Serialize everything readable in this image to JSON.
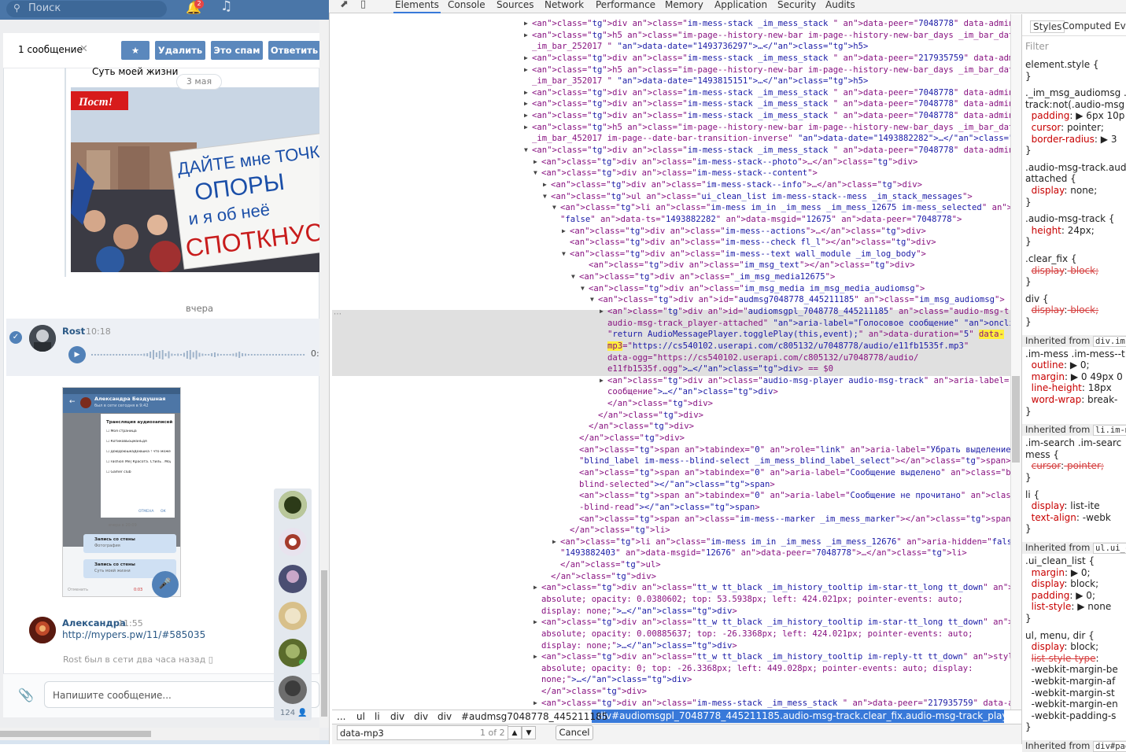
{
  "vk": {
    "search_placeholder": "Поиск",
    "notif_count": "2",
    "selection": {
      "count_label": "1 сообщение",
      "delete": "Удалить",
      "spam": "Это спам",
      "reply": "Ответить"
    },
    "msg1_text": "Суть моей жизни",
    "date_pill": "3 мая",
    "poster_badge": "Пост!",
    "poster_lines": [
      "ДАЙТЕ мне ТОЧКУ",
      "ОПОРЫ",
      "и я об неё",
      "СПОТКНУСЬ"
    ],
    "yesterday": "вчера",
    "rost": {
      "name": "Rost",
      "time": "10:18",
      "duration": "0:"
    },
    "shot": {
      "name": "Александра Бездушная",
      "status": "был в сети сегодня в 9:42",
      "dialog_title": "Трансляция аудиозаписей",
      "options": [
        "Моя страница",
        "КотиковБоцманЕдя",
        "ДоюДоюшкаДоюшка ! что может быть важнее",
        "Fashion Me| Красота. Стиль . Мода",
        "Gamer club"
      ],
      "cancel": "ОТМЕНА",
      "ok": "ОК",
      "date": "вчера в 20:09",
      "item1_title": "Запись со стены",
      "item1_sub": "Фотография",
      "item2_title": "Запись со стены",
      "item2_sub": "Суть моей жизни",
      "bottom_left": "Отменить",
      "bottom_right": "0:03"
    },
    "alex": {
      "name": "Александра",
      "time": "11:55",
      "link": "http://mypers.pw/11/#585035"
    },
    "online_note": "Rost был в сети два часа назад",
    "compose_placeholder": "Напишите сообщение...",
    "friends_count": "124"
  },
  "devtools": {
    "tabs": [
      "Elements",
      "Console",
      "Sources",
      "Network",
      "Performance",
      "Memory",
      "Application",
      "Security",
      "Audits"
    ],
    "active_tab": "Elements",
    "breadcrumbs": [
      "...",
      "ul",
      "li",
      "div",
      "div",
      "div",
      "#audmsg7048778_445211185"
    ],
    "breadcrumb_selected": "div#audiomsgpl_7048778_445211185.audio-msg-track.clear_fix.audio-msg-track_player-attached",
    "find_value": "data-mp3",
    "find_count": "1 of 2",
    "cancel": "Cancel",
    "styles_tabs": [
      "Styles",
      "Computed",
      "Eve"
    ],
    "filter": "Filter",
    "lines": [
      "<div class=\"im-mess-stack _im_mess_stack \" data-peer=\"7048778\" data-admin>…</div>",
      "<h5 class=\"im-page--history-new-bar im-page--history-new-bar_days _im_bar_date",
      "_im_bar_252017 \" data-date=\"1493736297\">…</h5>",
      "<div class=\"im-mess-stack _im_mess_stack \" data-peer=\"217935759\" data-admin>…</div>",
      "<h5 class=\"im-page--history-new-bar im-page--history-new-bar_days _im_bar_date",
      "_im_bar_352017 \" data-date=\"1493815151\">…</h5>",
      "<div class=\"im-mess-stack _im_mess_stack \" data-peer=\"7048778\" data-admin>…</div>",
      "<div class=\"im-mess-stack _im_mess_stack \" data-peer=\"7048778\" data-admin>…</div>",
      "<div class=\"im-mess-stack _im_mess_stack \" data-peer=\"7048778\" data-admin>…</div>",
      "<h5 class=\"im-page--history-new-bar im-page--history-new-bar_days _im_bar_date",
      "_im_bar_452017 im-page--date-bar-transition-inverse\" data-date=\"1493882282\">…</h5>",
      "<div class=\"im-mess-stack _im_mess_stack \" data-peer=\"7048778\" data-admin>",
      "<div class=\"im-mess-stack--photo\">…</div>",
      "<div class=\"im-mess-stack--content\">",
      "<div class=\"im-mess-stack--info\">…</div>",
      "<ul class=\"ui_clean_list im-mess-stack--mess _im_stack_messages\">",
      "<li class=\"im-mess im_in _im_mess _im_mess_12675 im-mess_selected\" aria-hidden=",
      "\"false\" data-ts=\"1493882282\" data-msgid=\"12675\" data-peer=\"7048778\">",
      "<div class=\"im-mess--actions\">…</div>",
      "<div class=\"im-mess--check fl_l\"></div>",
      "<div class=\"im-mess--text wall_module _im_log_body\">",
      "<div class=\"im_msg_text\"></div>",
      "<div class=\"_im_msg_media12675\">",
      "<div class=\"im_msg_media im_msg_media_audiomsg\">",
      "<div id=\"audmsg7048778_445211185\" class=\"im_msg_audiomsg\">",
      "<div id=\"audiomsgpl_7048778_445211185\" class=\"audio-msg-track clear_fix",
      "audio-msg-track_player-attached\" aria-label=\"Голосовое сообщение\" onclick=",
      "\"return AudioMessagePlayer.togglePlay(this,event);\" data-duration=\"5\" data-",
      "mp3=\"https://cs540102.userapi.com/c805132/u7048778/audio/e11fb1535f.mp3\"",
      "data-ogg=\"https://cs540102.userapi.com/c805132/u7048778/audio/",
      "e11fb1535f.ogg\">…</div> == $0",
      "<div class=\"audio-msg-player audio-msg-track\" aria-label=\"Голосовое",
      "сообщение\">…</div>",
      "</div>",
      "</div>",
      "</div>",
      "</div>",
      "<span tabindex=\"0\" role=\"link\" aria-label=\"Убрать выделение сообщения\" class=",
      "\"blind_label im-mess--blind-select _im_mess_blind_label_select\"></span>",
      "<span tabindex=\"0\" aria-label=\"Сообщение выделено\" class=\"blind_label im-mess--",
      "blind-selected\"></span>",
      "<span tabindex=\"0\" aria-label=\"Сообщение не прочитано\" class=\"blind_label im-mess-",
      "-blind-read\"></span>",
      "<span class=\"im-mess--marker _im_mess_marker\"></span>",
      "</li>",
      "<li class=\"im-mess im_in _im_mess _im_mess_12676\" aria-hidden=\"false\" data-ts=",
      "\"1493882403\" data-msgid=\"12676\" data-peer=\"7048778\">…</li>",
      "</ul>",
      "</div>",
      "<div class=\"tt_w tt_black _im_history_tooltip im-star-tt_long tt_down\" style=\"position:",
      "absolute; opacity: 0.0380602; top: 53.5938px; left: 424.021px; pointer-events: auto;",
      "display: none;\">…</div>",
      "<div class=\"tt_w tt_black _im_history_tooltip im-star-tt_long tt_down\" style=\"position:",
      "absolute; opacity: 0.00885637; top: -26.3368px; left: 424.021px; pointer-events: auto;",
      "display: none;\">…</div>",
      "<div class=\"tt_w tt_black _im_history_tooltip im-reply-tt tt_down\" style=\"position:",
      "absolute; opacity: 0; top: -26.3368px; left: 449.028px; pointer-events: auto; display:",
      "none;\">…</div>",
      "</div>",
      "<div class=\"im-mess-stack _im_mess_stack \" data-peer=\"217935759\" data-admin>…</div>"
    ],
    "styles": [
      "element.style {",
      "}",
      "._im_msg_audiomsg .au",
      "track:not(.audio-msg",
      "  padding: ▶ 6px 10p",
      "  cursor: pointer;",
      "  border-radius: ▶ 3",
      "}",
      ".audio-msg-track.aud",
      "attached {",
      "  display: none;",
      "}",
      ".audio-msg-track {",
      "  height: 24px;",
      "}",
      ".clear_fix {",
      "  display: block;",
      "}",
      "div {",
      "  display: block;",
      "}",
      "Inherited from div.im-",
      ".im-mess .im-mess--t",
      "  outline: ▶ 0;",
      "  margin: ▶ 0 49px 0",
      "  line-height: 18px",
      "  word-wrap: break-",
      "}",
      "Inherited from li.im-m",
      ".im-search .im-searc",
      "mess {",
      "  cursor: pointer;",
      "}",
      "li {",
      "  display: list-ite",
      "  text-align: -webk",
      "}",
      "Inherited from ul.ui_c",
      ".ui_clean_list {",
      "  margin: ▶ 0;",
      "  display: block;",
      "  padding: ▶ 0;",
      "  list-style: ▶ none",
      "}",
      "ul, menu, dir {",
      "  display: block;",
      "  list-style-type:",
      "  -webkit-margin-be",
      "  -webkit-margin-af",
      "  -webkit-margin-st",
      "  -webkit-margin-en",
      "  -webkit-padding-s",
      "}",
      "Inherited from div#pag"
    ]
  }
}
